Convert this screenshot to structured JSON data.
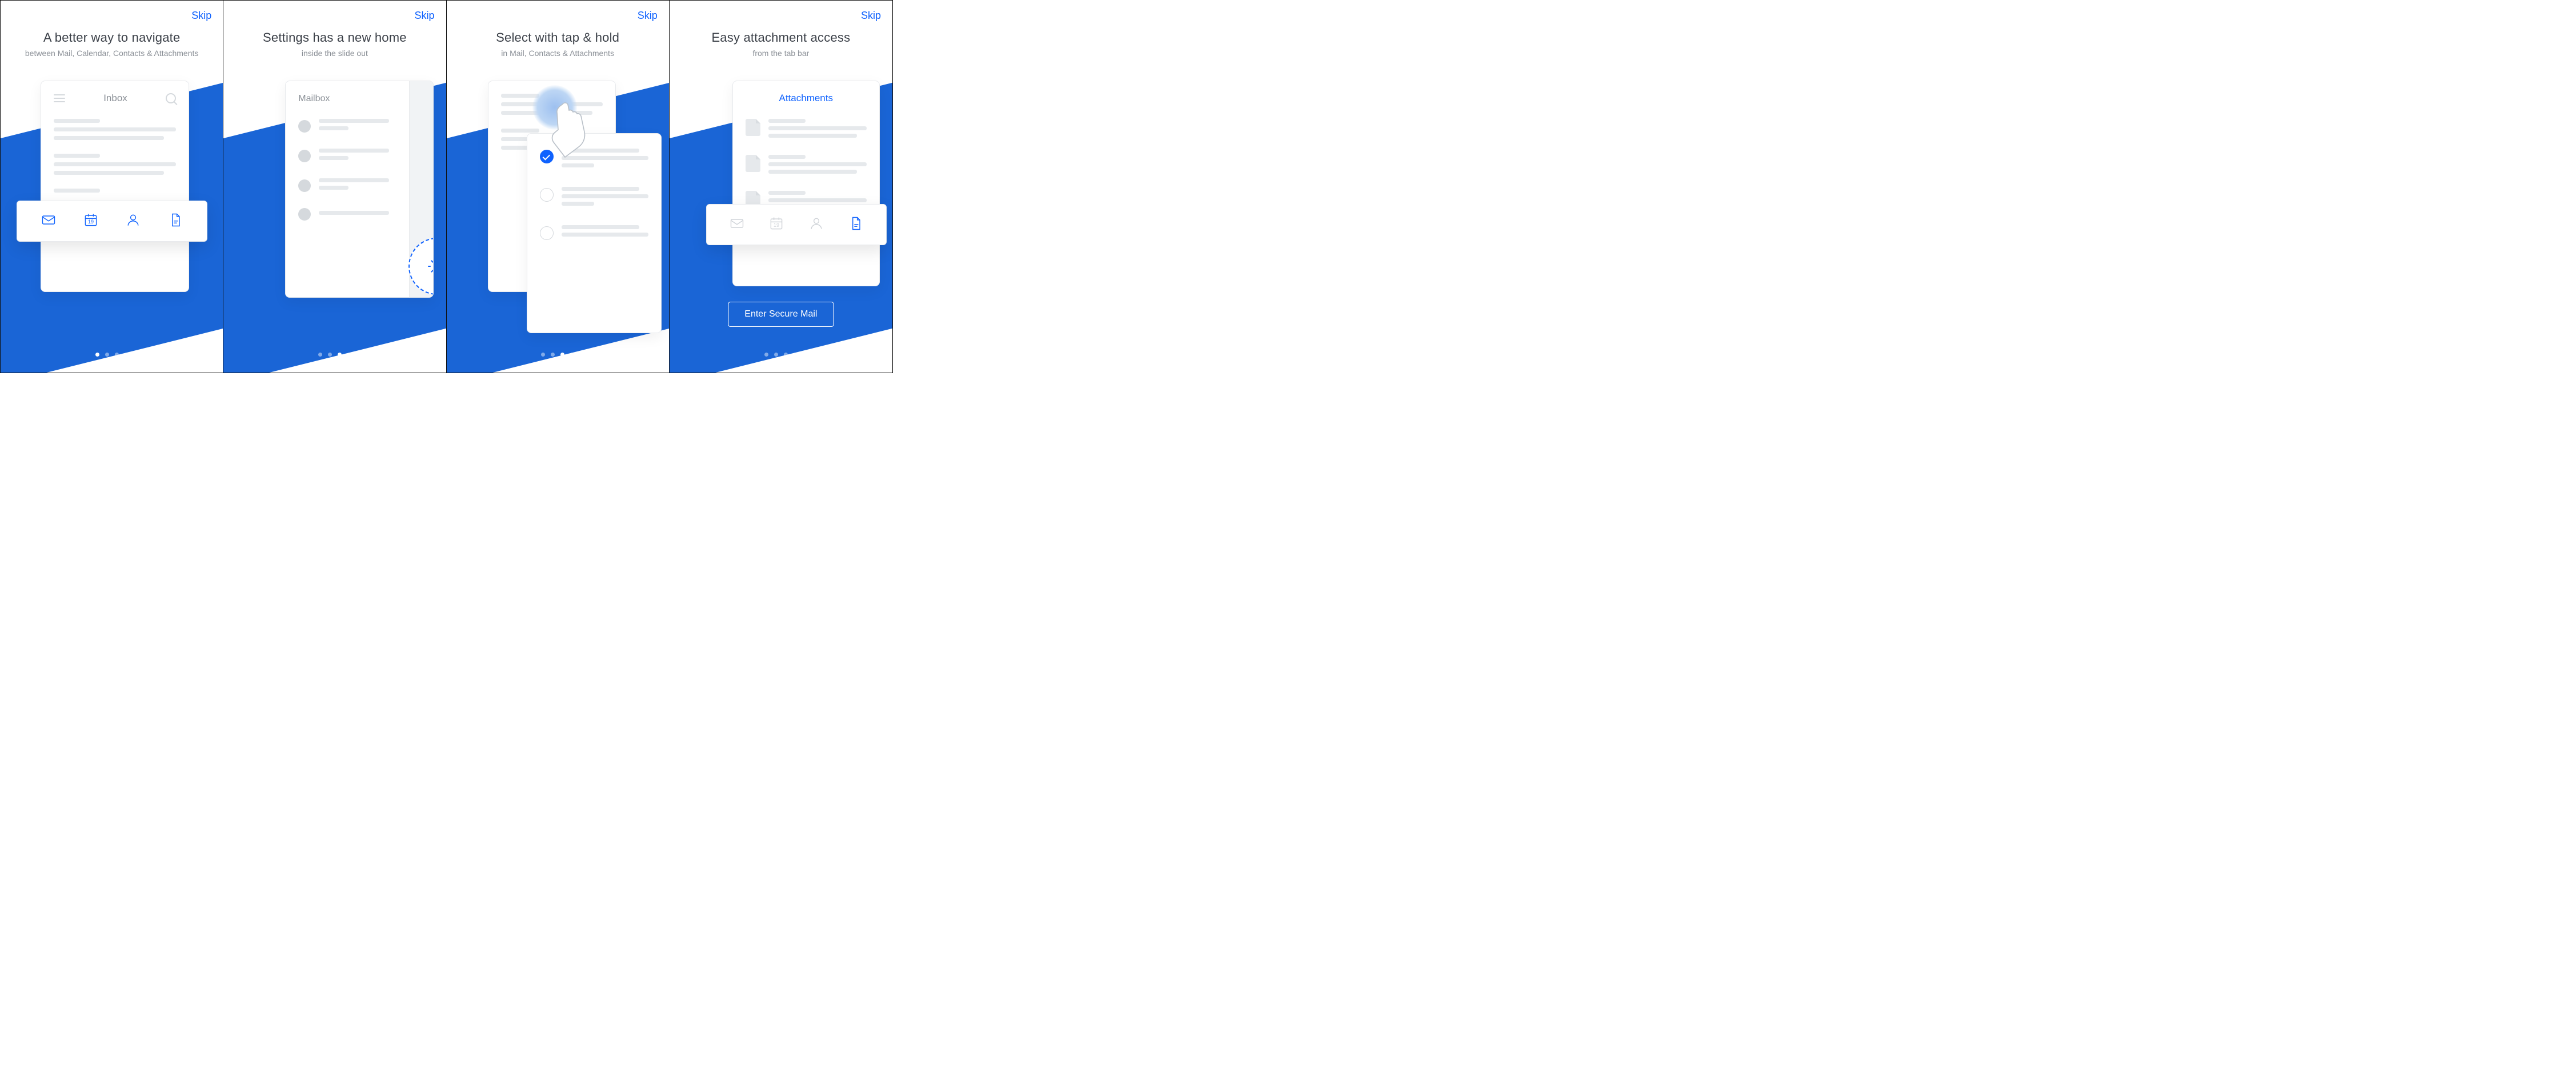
{
  "skip_label": "Skip",
  "calendar_day": "19",
  "screens": [
    {
      "title": "A better way to navigate",
      "subtitle": "between Mail, Calendar, Contacts & Attachments",
      "card_title": "Inbox",
      "active_dot": 0
    },
    {
      "title": "Settings has a new home",
      "subtitle": "inside the slide out",
      "card_title": "Mailbox",
      "active_dot": 2
    },
    {
      "title": "Select with tap & hold",
      "subtitle": "in Mail, Contacts & Attachments",
      "active_dot": 2
    },
    {
      "title": "Easy attachment access",
      "subtitle": "from the tab bar",
      "card_title": "Attachments",
      "cta": "Enter Secure Mail",
      "active_dot": 3
    }
  ]
}
